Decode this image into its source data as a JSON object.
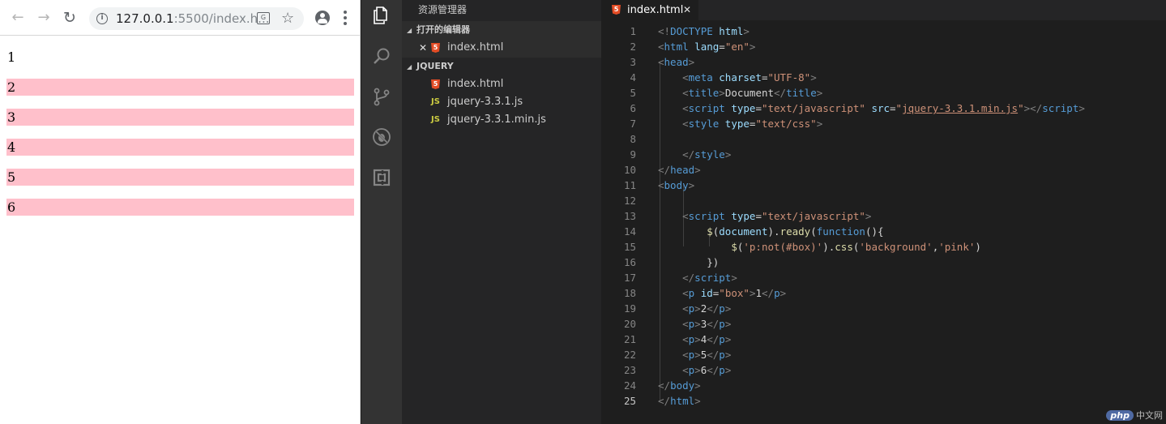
{
  "browser": {
    "url_host": "127.0.0.1",
    "url_rest": ":5500/index.h...",
    "paragraphs": [
      {
        "text": "1",
        "pink": false
      },
      {
        "text": "2",
        "pink": true
      },
      {
        "text": "3",
        "pink": true
      },
      {
        "text": "4",
        "pink": true
      },
      {
        "text": "5",
        "pink": true
      },
      {
        "text": "6",
        "pink": true
      }
    ],
    "highlight_color": "#ffc0cb"
  },
  "explorer": {
    "title": "资源管理器",
    "open_editors_label": "打开的编辑器",
    "open_editors": [
      {
        "name": "index.html",
        "icon": "html5-icon"
      }
    ],
    "project_label": "JQUERY",
    "files": [
      {
        "name": "index.html",
        "icon": "html5-icon"
      },
      {
        "name": "jquery-3.3.1.js",
        "icon": "js-icon"
      },
      {
        "name": "jquery-3.3.1.min.js",
        "icon": "js-icon"
      }
    ]
  },
  "editor": {
    "tab_label": "index.html",
    "current_line": 25,
    "lines": [
      [
        [
          "br",
          "<!"
        ],
        [
          "tag",
          "DOCTYPE "
        ],
        [
          "attr",
          "html"
        ],
        [
          "br",
          ">"
        ]
      ],
      [
        [
          "br",
          "<"
        ],
        [
          "tag",
          "html "
        ],
        [
          "attr",
          "lang"
        ],
        [
          "txt",
          "="
        ],
        [
          "str",
          "\"en\""
        ],
        [
          "br",
          ">"
        ]
      ],
      [
        [
          "br",
          "<"
        ],
        [
          "tag",
          "head"
        ],
        [
          "br",
          ">"
        ]
      ],
      [
        [
          "txt",
          "    "
        ],
        [
          "br",
          "<"
        ],
        [
          "tag",
          "meta "
        ],
        [
          "attr",
          "charset"
        ],
        [
          "txt",
          "="
        ],
        [
          "str",
          "\"UTF-8\""
        ],
        [
          "br",
          ">"
        ]
      ],
      [
        [
          "txt",
          "    "
        ],
        [
          "br",
          "<"
        ],
        [
          "tag",
          "title"
        ],
        [
          "br",
          ">"
        ],
        [
          "txt",
          "Document"
        ],
        [
          "br",
          "</"
        ],
        [
          "tag",
          "title"
        ],
        [
          "br",
          ">"
        ]
      ],
      [
        [
          "txt",
          "    "
        ],
        [
          "br",
          "<"
        ],
        [
          "tag",
          "script "
        ],
        [
          "attr",
          "type"
        ],
        [
          "txt",
          "="
        ],
        [
          "str",
          "\"text/javascript\" "
        ],
        [
          "attr",
          "src"
        ],
        [
          "txt",
          "="
        ],
        [
          "str",
          "\""
        ],
        [
          "link",
          "jquery-3.3.1.min.js"
        ],
        [
          "str",
          "\""
        ],
        [
          "br",
          "></"
        ],
        [
          "tag",
          "script"
        ],
        [
          "br",
          ">"
        ]
      ],
      [
        [
          "txt",
          "    "
        ],
        [
          "br",
          "<"
        ],
        [
          "tag",
          "style "
        ],
        [
          "attr",
          "type"
        ],
        [
          "txt",
          "="
        ],
        [
          "str",
          "\"text/css\""
        ],
        [
          "br",
          ">"
        ]
      ],
      [],
      [
        [
          "txt",
          "    "
        ],
        [
          "br",
          "</"
        ],
        [
          "tag",
          "style"
        ],
        [
          "br",
          ">"
        ]
      ],
      [
        [
          "br",
          "</"
        ],
        [
          "tag",
          "head"
        ],
        [
          "br",
          ">"
        ]
      ],
      [
        [
          "br",
          "<"
        ],
        [
          "tag",
          "body"
        ],
        [
          "br",
          ">"
        ]
      ],
      [],
      [
        [
          "txt",
          "    "
        ],
        [
          "br",
          "<"
        ],
        [
          "tag",
          "script "
        ],
        [
          "attr",
          "type"
        ],
        [
          "txt",
          "="
        ],
        [
          "str",
          "\"text/javascript\""
        ],
        [
          "br",
          ">"
        ]
      ],
      [
        [
          "txt",
          "        "
        ],
        [
          "fn",
          "$"
        ],
        [
          "txt",
          "("
        ],
        [
          "attr",
          "document"
        ],
        [
          "txt",
          ")."
        ],
        [
          "fn",
          "ready"
        ],
        [
          "txt",
          "("
        ],
        [
          "kw",
          "function"
        ],
        [
          "txt",
          "(){"
        ]
      ],
      [
        [
          "txt",
          "            "
        ],
        [
          "fn",
          "$"
        ],
        [
          "txt",
          "("
        ],
        [
          "str",
          "'p:not(#box)'"
        ],
        [
          "txt",
          ")."
        ],
        [
          "fn",
          "css"
        ],
        [
          "txt",
          "("
        ],
        [
          "str",
          "'background'"
        ],
        [
          "txt",
          ","
        ],
        [
          "str",
          "'pink'"
        ],
        [
          "txt",
          ")"
        ]
      ],
      [
        [
          "txt",
          "        })"
        ]
      ],
      [
        [
          "txt",
          "    "
        ],
        [
          "br",
          "</"
        ],
        [
          "tag",
          "script"
        ],
        [
          "br",
          ">"
        ]
      ],
      [
        [
          "txt",
          "    "
        ],
        [
          "br",
          "<"
        ],
        [
          "tag",
          "p "
        ],
        [
          "attr",
          "id"
        ],
        [
          "txt",
          "="
        ],
        [
          "str",
          "\"box\""
        ],
        [
          "br",
          ">"
        ],
        [
          "txt",
          "1"
        ],
        [
          "br",
          "</"
        ],
        [
          "tag",
          "p"
        ],
        [
          "br",
          ">"
        ]
      ],
      [
        [
          "txt",
          "    "
        ],
        [
          "br",
          "<"
        ],
        [
          "tag",
          "p"
        ],
        [
          "br",
          ">"
        ],
        [
          "txt",
          "2"
        ],
        [
          "br",
          "</"
        ],
        [
          "tag",
          "p"
        ],
        [
          "br",
          ">"
        ]
      ],
      [
        [
          "txt",
          "    "
        ],
        [
          "br",
          "<"
        ],
        [
          "tag",
          "p"
        ],
        [
          "br",
          ">"
        ],
        [
          "txt",
          "3"
        ],
        [
          "br",
          "</"
        ],
        [
          "tag",
          "p"
        ],
        [
          "br",
          ">"
        ]
      ],
      [
        [
          "txt",
          "    "
        ],
        [
          "br",
          "<"
        ],
        [
          "tag",
          "p"
        ],
        [
          "br",
          ">"
        ],
        [
          "txt",
          "4"
        ],
        [
          "br",
          "</"
        ],
        [
          "tag",
          "p"
        ],
        [
          "br",
          ">"
        ]
      ],
      [
        [
          "txt",
          "    "
        ],
        [
          "br",
          "<"
        ],
        [
          "tag",
          "p"
        ],
        [
          "br",
          ">"
        ],
        [
          "txt",
          "5"
        ],
        [
          "br",
          "</"
        ],
        [
          "tag",
          "p"
        ],
        [
          "br",
          ">"
        ]
      ],
      [
        [
          "txt",
          "    "
        ],
        [
          "br",
          "<"
        ],
        [
          "tag",
          "p"
        ],
        [
          "br",
          ">"
        ],
        [
          "txt",
          "6"
        ],
        [
          "br",
          "</"
        ],
        [
          "tag",
          "p"
        ],
        [
          "br",
          ">"
        ]
      ],
      [
        [
          "br",
          "</"
        ],
        [
          "tag",
          "body"
        ],
        [
          "br",
          ">"
        ]
      ],
      [
        [
          "br",
          "</"
        ],
        [
          "tag",
          "html"
        ],
        [
          "br",
          ">"
        ]
      ]
    ]
  },
  "watermark": {
    "logo": "php",
    "text": "中文网"
  }
}
